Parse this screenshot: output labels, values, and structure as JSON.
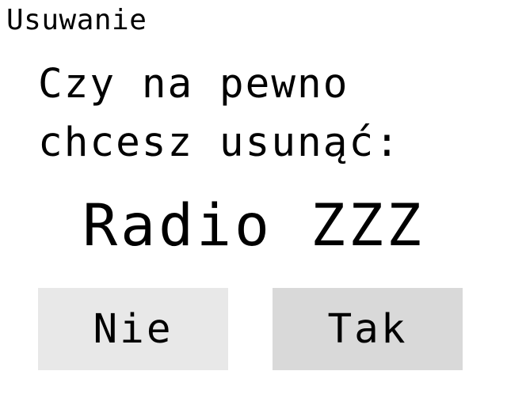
{
  "header": {
    "title": "Usuwanie"
  },
  "dialog": {
    "question_line1": "Czy na pewno",
    "question_line2": "chcesz usunąć:",
    "item_name": "Radio ZZZ"
  },
  "buttons": {
    "no_label": "Nie",
    "yes_label": "Tak"
  },
  "colors": {
    "background": "#ffffff",
    "text": "#000000",
    "no_button_bg": "#e8e8e8",
    "yes_button_bg": "#d9d9d9"
  }
}
